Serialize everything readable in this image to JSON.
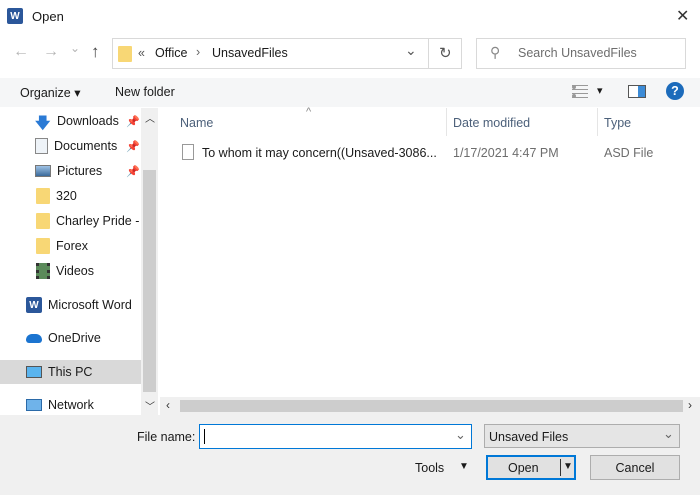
{
  "window": {
    "title": "Open",
    "close": "✕"
  },
  "nav": {
    "back": "←",
    "forward": "→",
    "recent": "⌄",
    "up": "↑"
  },
  "address": {
    "overflow": "«",
    "crumbs": [
      "Office",
      "UnsavedFiles"
    ],
    "sep": "›",
    "dropdown": "⌄",
    "refresh": "↻"
  },
  "search": {
    "placeholder": "Search UnsavedFiles",
    "icon": "⚲"
  },
  "toolbar": {
    "organize": "Organize ▾",
    "new_folder": "New folder",
    "view_caret": "▾",
    "help": "?"
  },
  "navpane": {
    "items": [
      {
        "label": "Downloads",
        "icon": "download-icon",
        "pinned": true
      },
      {
        "label": "Documents",
        "icon": "documents-icon",
        "pinned": true
      },
      {
        "label": "Pictures",
        "icon": "pictures-icon",
        "pinned": true
      },
      {
        "label": "320",
        "icon": "folder-icon"
      },
      {
        "label": "Charley Pride -",
        "icon": "folder-icon"
      },
      {
        "label": "Forex",
        "icon": "folder-icon"
      },
      {
        "label": "Videos",
        "icon": "videos-icon"
      },
      {
        "label": "Microsoft Word",
        "icon": "word-icon"
      },
      {
        "label": "OneDrive",
        "icon": "onedrive-icon"
      },
      {
        "label": "This PC",
        "icon": "pc-icon",
        "selected": true
      },
      {
        "label": "Network",
        "icon": "network-icon"
      }
    ],
    "pin": "📌"
  },
  "filelist": {
    "columns": [
      "Name",
      "Date modified",
      "Type"
    ],
    "sort_arrow": "^",
    "rows": [
      {
        "name": "To whom it may concern((Unsaved-3086...",
        "date": "1/17/2021 4:47 PM",
        "type": "ASD File"
      }
    ]
  },
  "bottom": {
    "file_name_label": "File name:",
    "file_name_value": "",
    "filter": "Unsaved Files",
    "tools": "Tools",
    "open": "Open",
    "cancel": "Cancel"
  }
}
